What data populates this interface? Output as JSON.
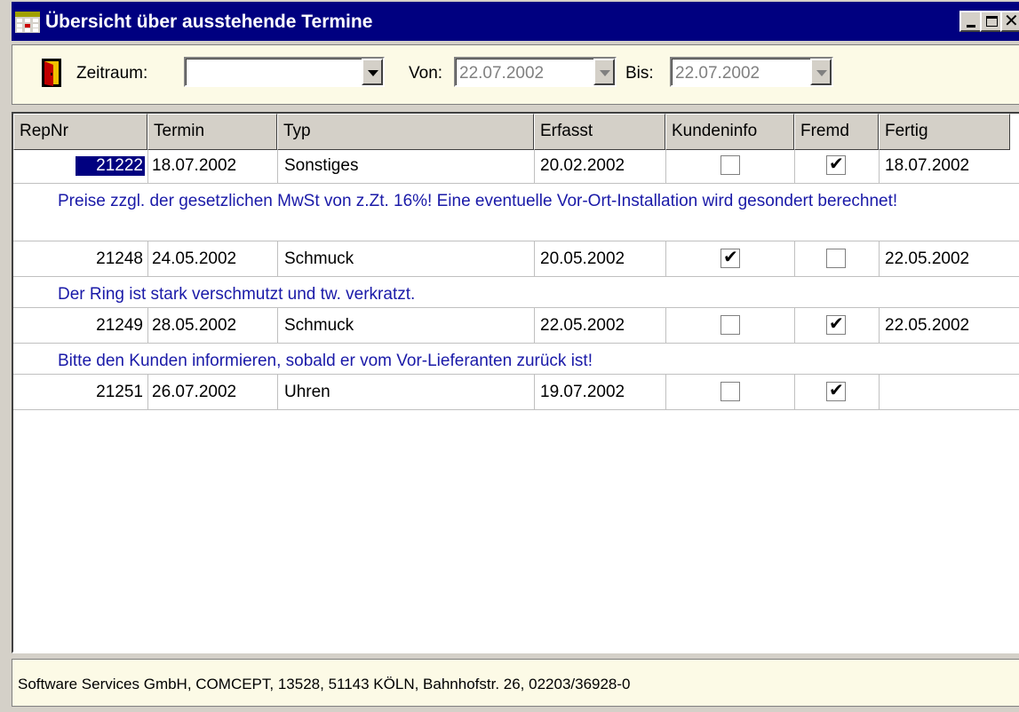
{
  "window": {
    "title": "Übersicht über ausstehende Termine"
  },
  "toolbar": {
    "zeitraum_label": "Zeitraum:",
    "zeitraum_value": "",
    "von_label": "Von:",
    "von_value": "22.07.2002",
    "bis_label": "Bis:",
    "bis_value": "22.07.2002"
  },
  "table": {
    "headers": [
      "RepNr",
      "Termin",
      "Typ",
      "Erfasst",
      "Kundeninfo",
      "Fremd",
      "Fertig"
    ],
    "rows": [
      {
        "repnr": "21222",
        "termin": "18.07.2002",
        "typ": "Sonstiges",
        "erfasst": "20.02.2002",
        "kundeninfo": false,
        "fremd": true,
        "fertig": "18.07.2002",
        "note": "Preise zzgl. der gesetzlichen MwSt von z.Zt. 16%! Eine eventuelle Vor-Ort-Installation wird gesondert berechnet!"
      },
      {
        "repnr": "21248",
        "termin": "24.05.2002",
        "typ": "Schmuck",
        "erfasst": "20.05.2002",
        "kundeninfo": true,
        "fremd": false,
        "fertig": "22.05.2002",
        "note": "Der Ring ist stark verschmutzt und tw. verkratzt."
      },
      {
        "repnr": "21249",
        "termin": "28.05.2002",
        "typ": "Schmuck",
        "erfasst": "22.05.2002",
        "kundeninfo": false,
        "fremd": true,
        "fertig": "22.05.2002",
        "note": "Bitte den Kunden informieren, sobald er vom Vor-Lieferanten zurück ist!"
      },
      {
        "repnr": "21251",
        "termin": "26.07.2002",
        "typ": "Uhren",
        "erfasst": "19.07.2002",
        "kundeninfo": false,
        "fremd": true,
        "fertig": "",
        "note": ""
      }
    ],
    "checkmark": "✔"
  },
  "statusbar": {
    "text": "Software Services GmbH, COMCEPT, 13528, 51143 KÖLN, Bahnhofstr. 26, 02203/36928-0"
  },
  "colors": {
    "titlebar": "#000080",
    "note_text": "#1a1aa8",
    "toolbar_bg": "#fcfae6"
  },
  "icons": {
    "app": "calendar-grid-icon",
    "exit": "door-exit-icon"
  }
}
